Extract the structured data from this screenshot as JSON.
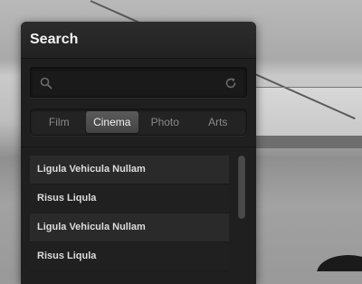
{
  "panel": {
    "title": "Search"
  },
  "search": {
    "value": "",
    "placeholder": ""
  },
  "icons": {
    "search": "search-icon",
    "refresh": "refresh-icon"
  },
  "tabs": [
    {
      "label": "Film",
      "active": false
    },
    {
      "label": "Cinema",
      "active": true
    },
    {
      "label": "Photo",
      "active": false
    },
    {
      "label": "Arts",
      "active": false
    }
  ],
  "list": {
    "items": [
      {
        "label": "Ligula Vehicula Nullam"
      },
      {
        "label": "Risus Liqula"
      },
      {
        "label": "Ligula Vehicula Nullam"
      },
      {
        "label": "Risus Liqula"
      }
    ]
  },
  "colors": {
    "panel_bg": "#1f1f1f",
    "active_tab": "#4f4f4f",
    "text": "#dcdcdc"
  }
}
